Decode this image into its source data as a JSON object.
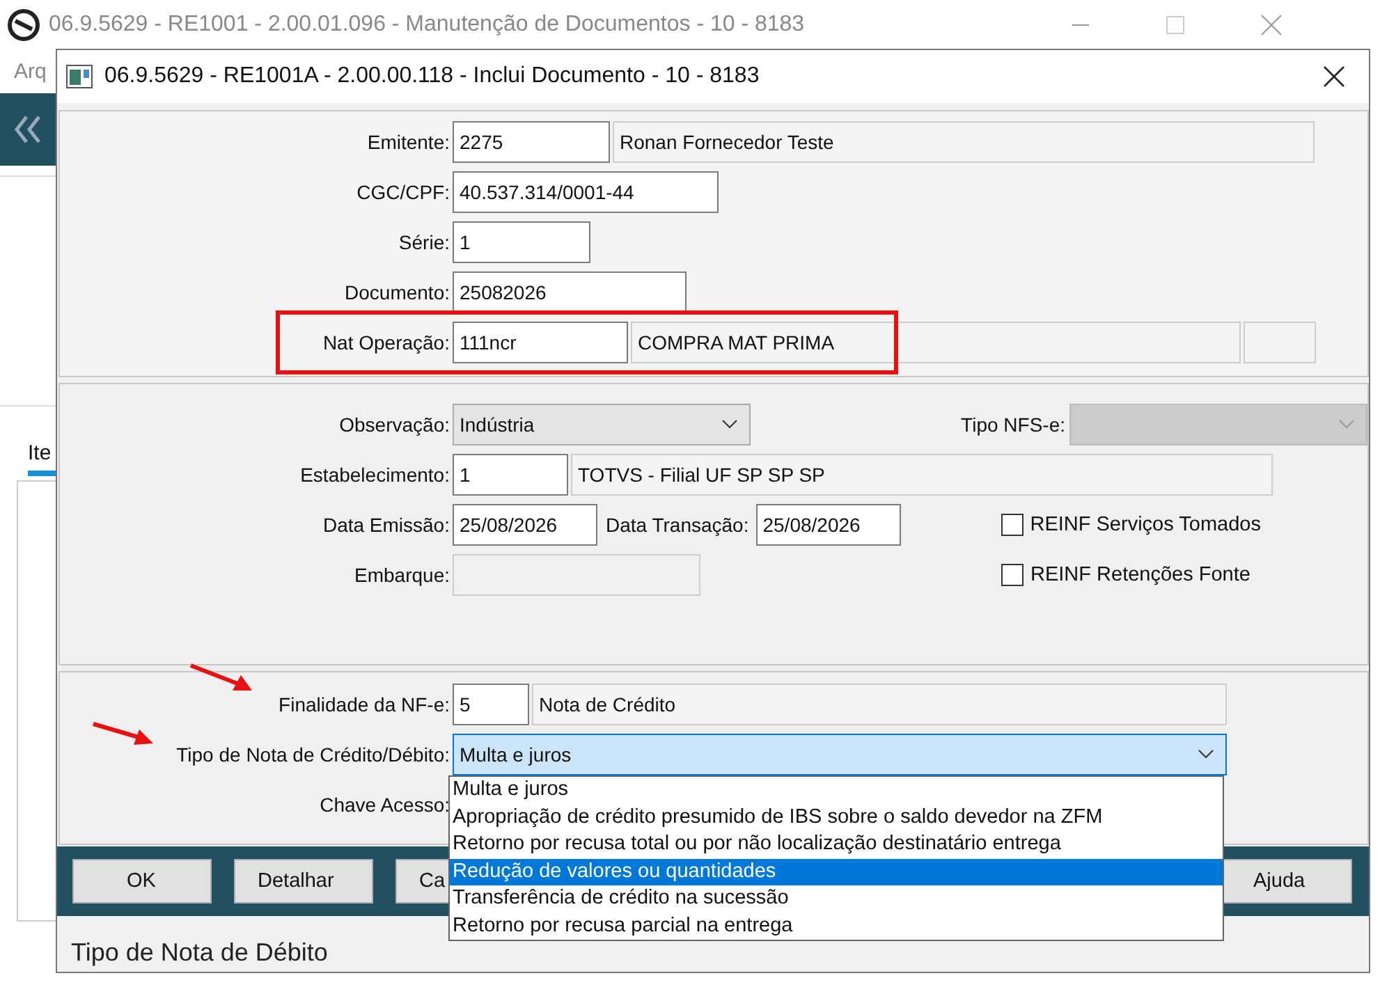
{
  "background_window": {
    "title": "06.9.5629 - RE1001 - 2.00.01.096 - Manutenção de Documentos - 10 - 8183",
    "menu_item": "Arq",
    "tab_label": "Ite"
  },
  "dialog": {
    "title": "06.9.5629 - RE1001A - 2.00.00.118 - Inclui Documento - 10 - 8183"
  },
  "header": {
    "emitente": {
      "label": "Emitente:",
      "value": "2275",
      "description": "Ronan Fornecedor Teste"
    },
    "cgc_cpf": {
      "label": "CGC/CPF:",
      "value": "40.537.314/0001-44"
    },
    "serie": {
      "label": "Série:",
      "value": "1"
    },
    "documento": {
      "label": "Documento:",
      "value": "25082026"
    },
    "nat_operacao": {
      "label": "Nat Operação:",
      "value": "111ncr",
      "description": "COMPRA MAT PRIMA"
    }
  },
  "details": {
    "observacao": {
      "label": "Observação:",
      "value": "Indústria"
    },
    "tipo_nfse": {
      "label": "Tipo NFS-e:",
      "disabled": true
    },
    "estabelecimento": {
      "label": "Estabelecimento:",
      "value": "1",
      "description": "TOTVS - Filial UF SP SP SP"
    },
    "data_emissao": {
      "label": "Data Emissão:",
      "value": "25/08/2026"
    },
    "data_transacao": {
      "label": "Data Transação:",
      "value": "25/08/2026"
    },
    "embarque": {
      "label": "Embarque:",
      "disabled": true
    },
    "checkboxes": [
      {
        "label": "REINF Serviços Tomados",
        "checked": false
      },
      {
        "label": "REINF Retenções Fonte",
        "checked": false
      }
    ]
  },
  "nfe": {
    "finalidade": {
      "label": "Finalidade da NF-e:",
      "value": "5",
      "description": "Nota de Crédito"
    },
    "tipo_nota": {
      "label": "Tipo de Nota de Crédito/Débito:",
      "value": "Multa e juros",
      "expanded": true,
      "options": [
        {
          "label": "Multa e juros",
          "highlighted": false
        },
        {
          "label": "Apropriação de crédito presumido de IBS sobre o saldo devedor na ZFM",
          "highlighted": false
        },
        {
          "label": "Retorno por recusa total ou por não localização destinatário entrega",
          "highlighted": false
        },
        {
          "label": "Redução de valores ou quantidades",
          "highlighted": true
        },
        {
          "label": "Transferência de crédito na sucessão",
          "highlighted": false
        },
        {
          "label": "Retorno por recusa parcial na entrega",
          "highlighted": false
        }
      ]
    },
    "chave_acesso": {
      "label": "Chave Acesso:"
    }
  },
  "buttons": [
    "OK",
    "Detalhar",
    "Ca",
    "Ajuda"
  ],
  "status_bar": "Tipo de Nota de Débito"
}
